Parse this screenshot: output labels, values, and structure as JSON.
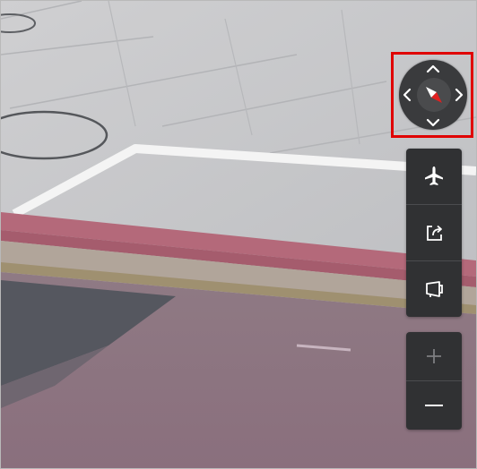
{
  "window": {
    "title": ""
  },
  "map": {
    "view": "street-level-imagery"
  },
  "compass": {
    "highlighted": true,
    "highlight_color": "#e00000",
    "icons": [
      "chevron-up-icon",
      "chevron-down-icon",
      "chevron-left-icon",
      "chevron-right-icon",
      "compass-needle-icon"
    ]
  },
  "toolbar": {
    "buttons": [
      {
        "icon": "airplane-icon"
      },
      {
        "icon": "share-icon"
      },
      {
        "icon": "projector-screen-icon"
      }
    ]
  },
  "zoom": {
    "in_icon": "plus-icon",
    "out_icon": "minus-icon"
  }
}
